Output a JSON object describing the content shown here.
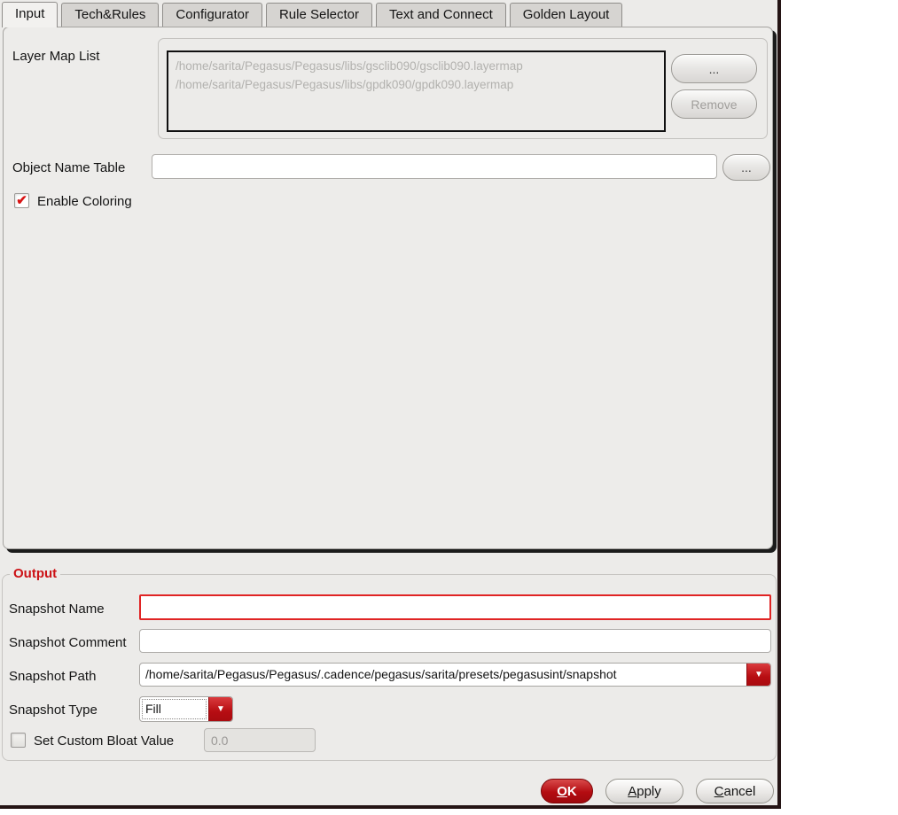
{
  "tabs": [
    {
      "label": "Input",
      "active": true
    },
    {
      "label": "Tech&Rules",
      "active": false
    },
    {
      "label": "Configurator",
      "active": false
    },
    {
      "label": "Rule Selector",
      "active": false
    },
    {
      "label": "Text and Connect",
      "active": false
    },
    {
      "label": "Golden Layout",
      "active": false
    }
  ],
  "input_tab": {
    "layer_map_list": {
      "label": "Layer Map List",
      "items": [
        "/home/sarita/Pegasus/Pegasus/libs/gsclib090/gsclib090.layermap",
        "/home/sarita/Pegasus/Pegasus/libs/gpdk090/gpdk090.layermap"
      ],
      "browse_label": "...",
      "remove_label": "Remove"
    },
    "object_name_table": {
      "label": "Object Name Table",
      "value": "",
      "browse_label": "..."
    },
    "enable_coloring": {
      "label": "Enable Coloring",
      "checked": true
    }
  },
  "output": {
    "title": "Output",
    "snapshot_name": {
      "label": "Snapshot Name",
      "value": ""
    },
    "snapshot_comment": {
      "label": "Snapshot Comment",
      "value": ""
    },
    "snapshot_path": {
      "label": "Snapshot Path",
      "value": "/home/sarita/Pegasus/Pegasus/.cadence/pegasus/sarita/presets/pegasusint/snapshot"
    },
    "snapshot_type": {
      "label": "Snapshot Type",
      "value": "Fill"
    },
    "custom_bloat": {
      "label": "Set Custom Bloat Value",
      "checked": false,
      "value": "0.0"
    }
  },
  "actions": {
    "ok": "OK",
    "apply": "Apply",
    "cancel": "Cancel"
  },
  "icons": {
    "check": "✔",
    "dropdown_arrow": "▼"
  },
  "colors": {
    "accent_red": "#c01216",
    "error_border": "#e02424",
    "dialog_bg": "#ecebe9",
    "disabled_text": "#a09e9b",
    "path_text_gray": "#b2b1ae"
  }
}
